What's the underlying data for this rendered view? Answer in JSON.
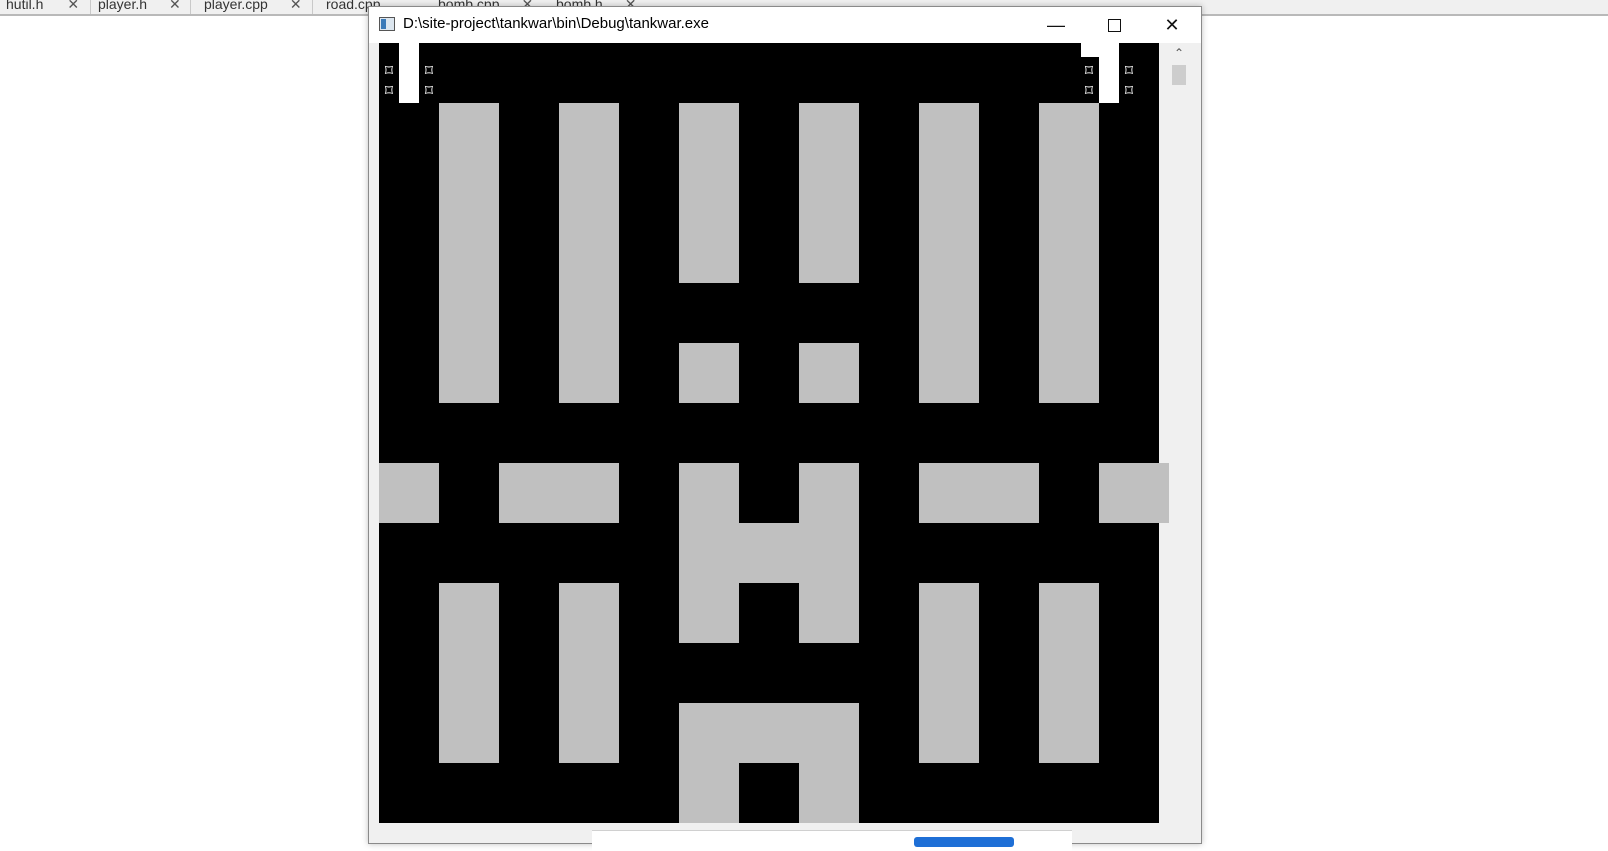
{
  "ide": {
    "tabs": [
      {
        "label": "hutil.h"
      },
      {
        "label": "player.h"
      },
      {
        "label": "player.cpp"
      },
      {
        "label": "road.cpp"
      },
      {
        "label": "bomb.cpp"
      },
      {
        "label": "bomb.h"
      }
    ],
    "close_glyph": "✕"
  },
  "window": {
    "title": "D:\\site-project\\tankwar\\bin\\Debug\\tankwar.exe",
    "icon": "console-app-icon",
    "controls": {
      "minimize": "—",
      "maximize": "maximize-icon",
      "close": "✕"
    }
  },
  "game": {
    "background_color": "#000000",
    "wall_color": "#c0c0c0",
    "player_tank_glyph": "⌑",
    "scroll_up_glyph": "⌃"
  }
}
